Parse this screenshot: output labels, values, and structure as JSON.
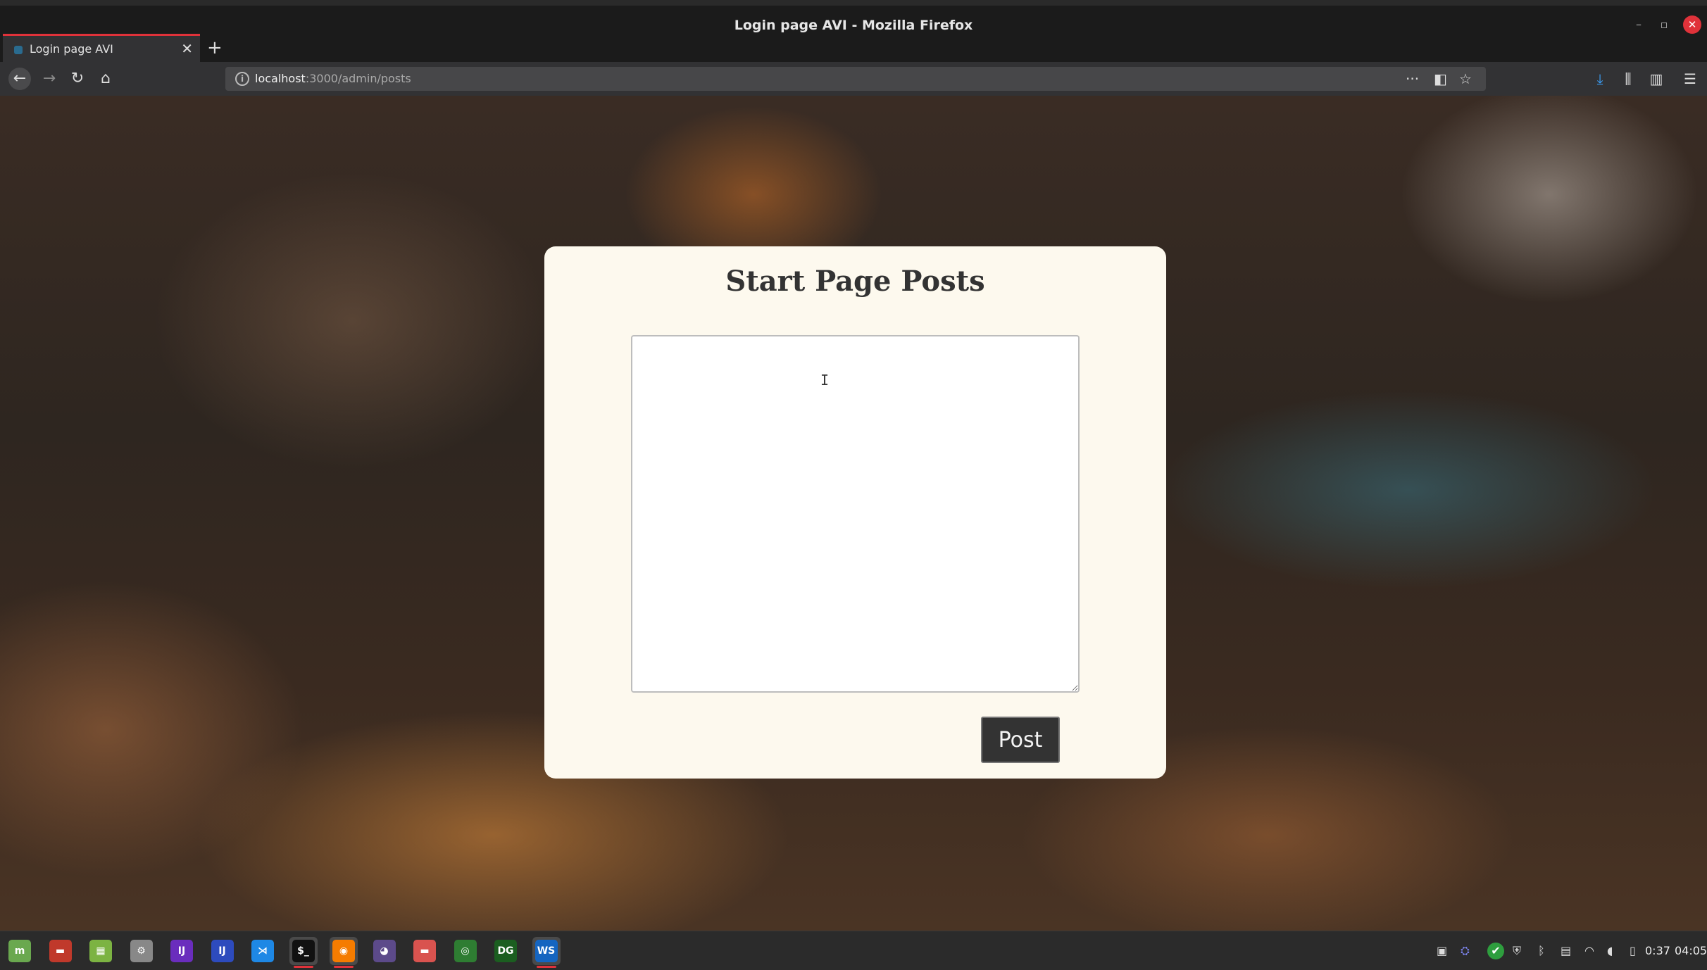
{
  "window": {
    "title": "Login page AVI - Mozilla Firefox",
    "controls": {
      "minimize": "–",
      "maximize": "▫",
      "close": "✕"
    }
  },
  "tabs": [
    {
      "label": "Login page AVI",
      "close": "✕"
    }
  ],
  "new_tab": "+",
  "nav": {
    "back": "←",
    "forward": "→",
    "reload": "↻",
    "home": "⌂",
    "url_host": "localhost",
    "url_rest": ":3000/admin/posts",
    "info": "i",
    "page_actions": "···",
    "pocket": "◧",
    "bookmark": "☆",
    "downloads": "⤓",
    "library": "⫼",
    "sidebar": "▥",
    "menu": "☰"
  },
  "card": {
    "title": "Start Page Posts",
    "textarea_value": "",
    "caret": "I",
    "post_label": "Post"
  },
  "taskbar": {
    "apps": [
      {
        "name": "mint-menu-icon",
        "glyph": "m",
        "color": "#6aa84f"
      },
      {
        "name": "folder-red-icon",
        "glyph": "▬",
        "color": "#c0392b"
      },
      {
        "name": "spreadsheet-icon",
        "glyph": "▦",
        "color": "#7cb342"
      },
      {
        "name": "settings-toggle-icon",
        "glyph": "⚙",
        "color": "#888"
      },
      {
        "name": "intellij-icon",
        "glyph": "IJ",
        "color": "#6a2dbd"
      },
      {
        "name": "intellij-ce-icon",
        "glyph": "IJ",
        "color": "#2d4bbd"
      },
      {
        "name": "vscode-icon",
        "glyph": "⋊",
        "color": "#1e88e5"
      },
      {
        "name": "terminal-icon",
        "glyph": "$_",
        "color": "#111"
      },
      {
        "name": "firefox-icon",
        "glyph": "◉",
        "color": "#f57c00"
      },
      {
        "name": "github-icon",
        "glyph": "◕",
        "color": "#5c4a8a"
      },
      {
        "name": "files-icon",
        "glyph": "▬",
        "color": "#d9534f"
      },
      {
        "name": "chrome-icon",
        "glyph": "◎",
        "color": "#2e7d32"
      },
      {
        "name": "datagrip-icon",
        "glyph": "DG",
        "color": "#1b5e20"
      },
      {
        "name": "webstorm-icon",
        "glyph": "WS",
        "color": "#1565c0"
      }
    ],
    "tray": {
      "camera": "▣",
      "teams": "⛭",
      "check": "✔",
      "shield": "⛨",
      "bluetooth": "ᛒ",
      "clipboard": "▤",
      "wifi": "◠",
      "volume": "◖",
      "battery": "▯"
    },
    "battery_time": "0:37",
    "clock": "04:05"
  }
}
